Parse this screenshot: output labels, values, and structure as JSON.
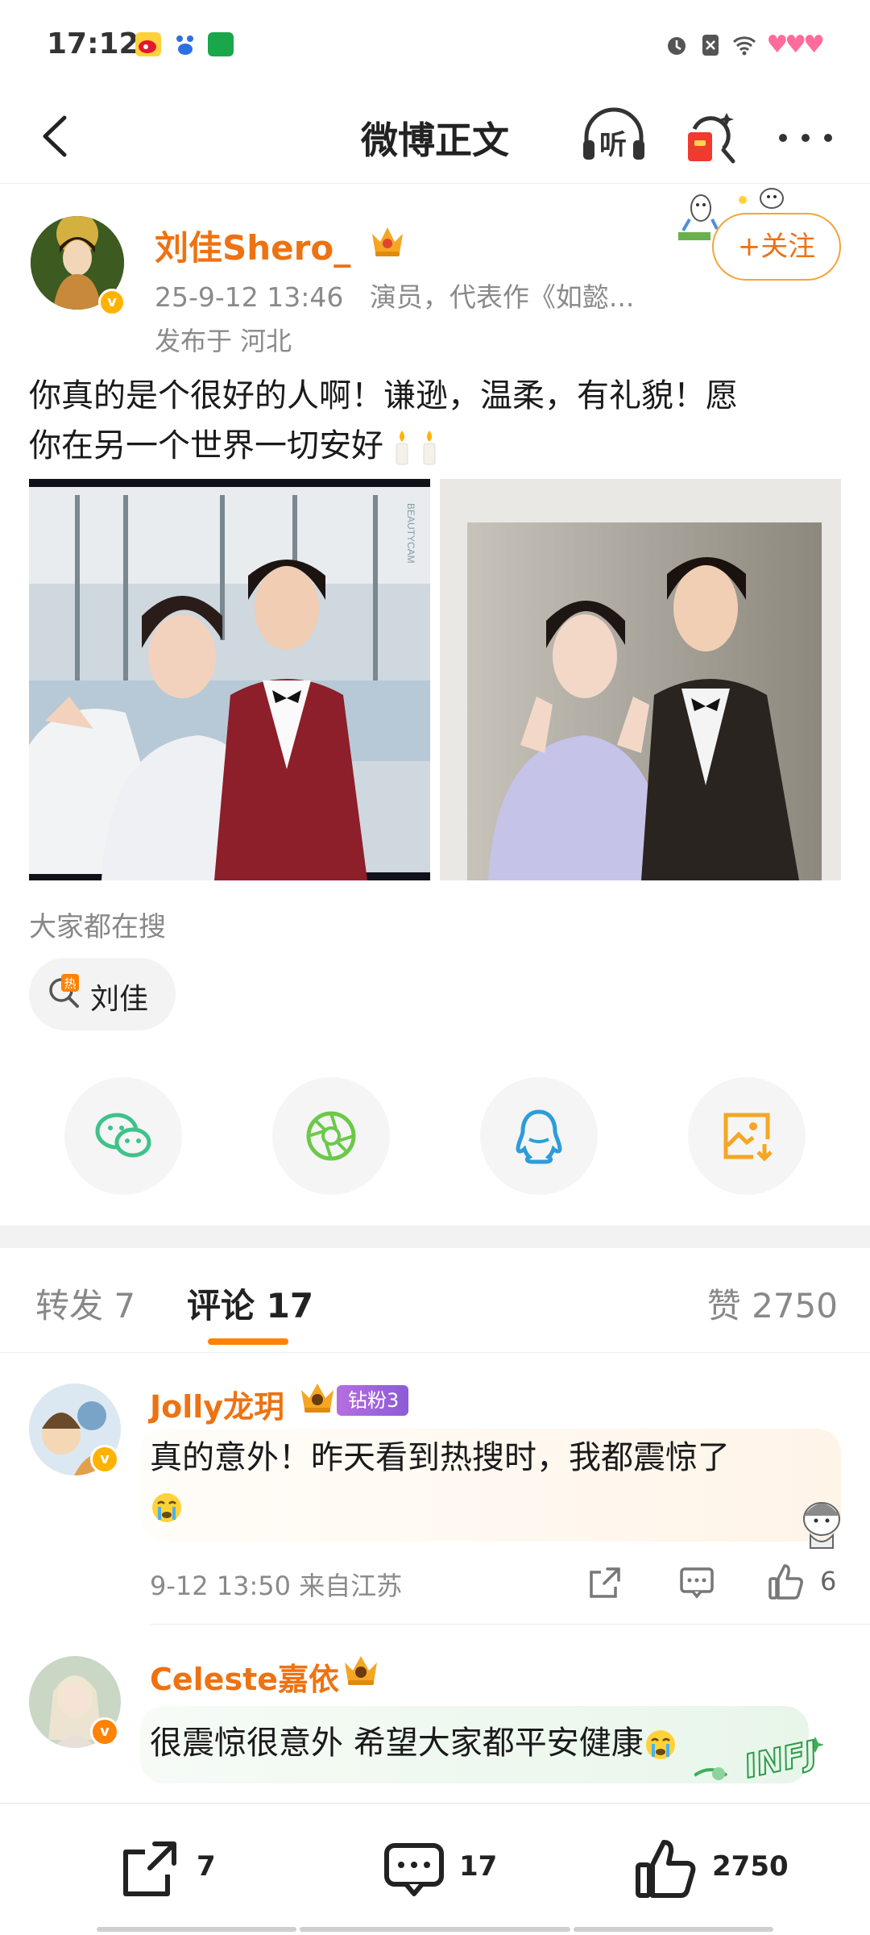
{
  "status": {
    "time": "17:12"
  },
  "nav": {
    "title": "微博正文",
    "listen_label": "听"
  },
  "post": {
    "author": "刘佳Shero_",
    "time": "25-9-12 13:46",
    "description": "演员，代表作《如懿...",
    "location": "发布于 河北",
    "follow_label": "+关注",
    "text_line1": "你真的是个很好的人啊！谦逊，温柔，有礼貌！愿",
    "text_line2": "你在另一个世界一切安好",
    "photo1_watermark": "BEAUTYCAM"
  },
  "search": {
    "label": "大家都在搜",
    "hot_tag": "热",
    "chip": "刘佳"
  },
  "share": [
    "wechat-icon",
    "moments-icon",
    "qq-icon",
    "save-image-icon"
  ],
  "tabs": {
    "repost": "转发 7",
    "comment": "评论 17",
    "like": "赞 2750"
  },
  "comments": [
    {
      "name": "Jolly龙玥",
      "fan_badge": "钻粉3",
      "text_line1": "真的意外！昨天看到热搜时，我都震惊了",
      "time": "9-12 13:50 来自江苏",
      "likes": "6"
    },
    {
      "name": "Celeste嘉依",
      "text": "很震惊很意外 希望大家都平安健康",
      "sticker": "INFJ"
    }
  ],
  "bottom": {
    "repost": "7",
    "comment": "17",
    "like": "2750"
  },
  "colors": {
    "accent": "#ff8200",
    "name": "#ee7212",
    "meta": "#8a8a8a"
  }
}
